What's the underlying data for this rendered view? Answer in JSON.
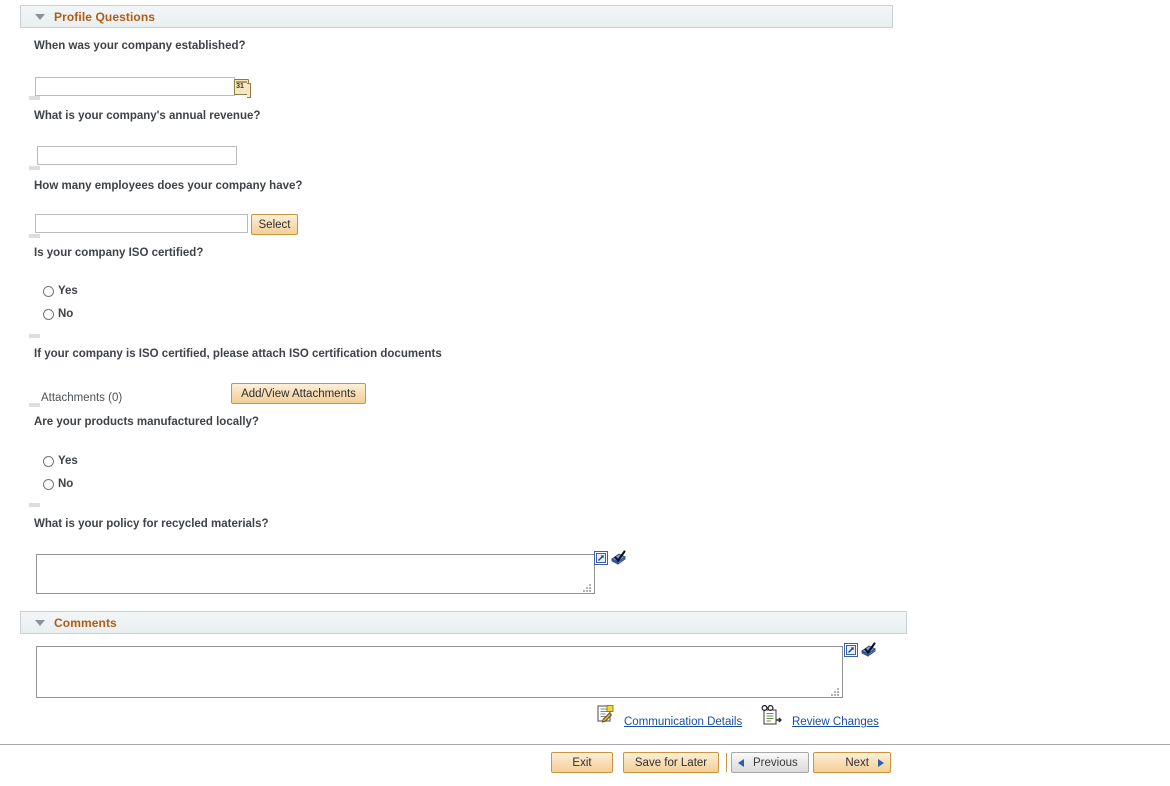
{
  "sections": {
    "profile": {
      "title": "Profile Questions",
      "collapse_icon": "caret-down-icon"
    },
    "comments": {
      "title": "Comments",
      "collapse_icon": "caret-down-icon"
    }
  },
  "questions": [
    {
      "id": "established",
      "label": "When was your company established?",
      "type": "date",
      "value": "",
      "icon": "calendar-icon",
      "icon_text": "31"
    },
    {
      "id": "annual_revenue",
      "label": "What is your company's annual revenue?",
      "type": "text",
      "value": ""
    },
    {
      "id": "employee_count",
      "label": "How many employees does your company have?",
      "type": "lookup",
      "value": "",
      "button_label": "Select"
    },
    {
      "id": "iso_certified",
      "label": "Is your company ISO certified?",
      "type": "radio",
      "options": [
        "Yes",
        "No"
      ],
      "selected": ""
    },
    {
      "id": "iso_attachments",
      "label": "If your company is ISO certified, please attach ISO certification documents",
      "type": "attachment",
      "count_label": "Attachments (0)",
      "button_label": "Add/View Attachments"
    },
    {
      "id": "manufactured_locally",
      "label": "Are your products manufactured locally?",
      "type": "radio",
      "options": [
        "Yes",
        "No"
      ],
      "selected": ""
    },
    {
      "id": "recycled_policy",
      "label": "What is your policy for recycled materials?",
      "type": "textarea",
      "value": "",
      "expand_icon": "expand-popup-icon",
      "spellcheck_icon": "spellcheck-icon"
    }
  ],
  "comments_field": {
    "value": "",
    "expand_icon": "expand-popup-icon",
    "spellcheck_icon": "spellcheck-icon"
  },
  "footer_links": [
    {
      "id": "communication_details",
      "label": "Communication Details",
      "icon": "communication-details-icon"
    },
    {
      "id": "review_changes",
      "label": "Review Changes",
      "icon": "review-changes-icon"
    }
  ],
  "footer_buttons": [
    {
      "id": "exit",
      "label": "Exit",
      "state": "enabled",
      "icon": ""
    },
    {
      "id": "save_for_later",
      "label": "Save for Later",
      "state": "enabled",
      "icon": ""
    },
    {
      "id": "previous",
      "label": "Previous",
      "state": "disabled",
      "icon": "arrow-left-icon"
    },
    {
      "id": "next",
      "label": "Next",
      "state": "enabled",
      "icon": "arrow-right-icon"
    }
  ],
  "colors": {
    "section_title": "#b05c14",
    "link": "#1a4f9c",
    "button_face": "#f8ddb5",
    "button_border": "#c9963f",
    "label_text": "#3f4347",
    "section_bar_bg": "#eef2f4"
  }
}
